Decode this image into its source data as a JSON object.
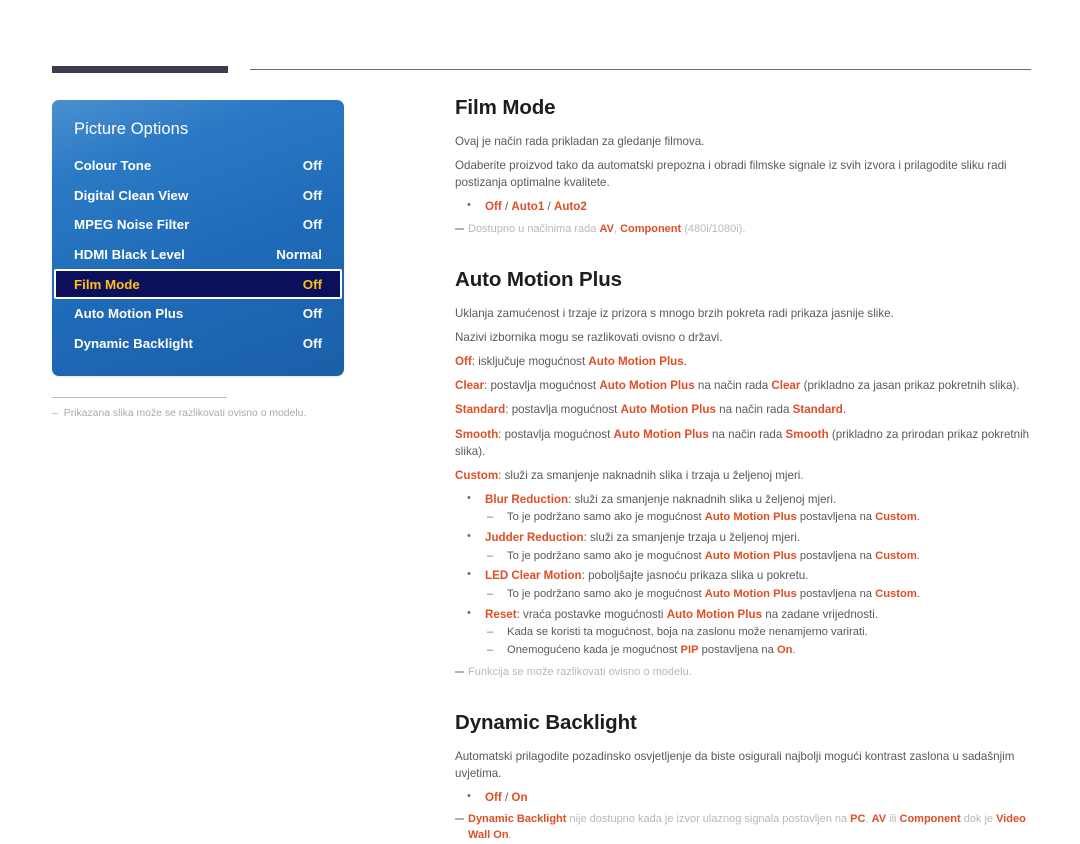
{
  "header": {
    "rule_left": "dark-rule",
    "rule_right": "thin-rule"
  },
  "osd": {
    "title": "Picture Options",
    "rows": [
      {
        "label": "Colour Tone",
        "value": "Off",
        "selected": false
      },
      {
        "label": "Digital Clean View",
        "value": "Off",
        "selected": false
      },
      {
        "label": "MPEG Noise Filter",
        "value": "Off",
        "selected": false
      },
      {
        "label": "HDMI Black Level",
        "value": "Normal",
        "selected": false
      },
      {
        "label": "Film Mode",
        "value": "Off",
        "selected": true
      },
      {
        "label": "Auto Motion Plus",
        "value": "Off",
        "selected": false
      },
      {
        "label": "Dynamic Backlight",
        "value": "Off",
        "selected": false
      }
    ],
    "footnote_dash": "–",
    "footnote": "Prikazana slika može se razlikovati ovisno o modelu."
  },
  "sections": {
    "film_mode": {
      "title": "Film Mode",
      "p1": "Ovaj je način rada prikladan za gledanje filmova.",
      "p2": "Odaberite proizvod tako da automatski prepozna i obradi filmske signale iz svih izvora i prilagodite sliku radi postizanja optimalne kvalitete.",
      "option_off": "Off",
      "option_sep1": " / ",
      "option_auto1": "Auto1",
      "option_sep2": " / ",
      "option_auto2": "Auto2",
      "note_pre": "Dostupno u načinima rada ",
      "note_av": "AV",
      "note_comma": ", ",
      "note_component": "Component",
      "note_post": " (480i/1080i)."
    },
    "auto_motion_plus": {
      "title": "Auto Motion Plus",
      "p1": "Uklanja zamućenost i trzaje iz prizora s mnogo brzih pokreta radi prikaza jasnije slike.",
      "p2": "Nazivi izbornika mogu se razlikovati ovisno o državi.",
      "off_key": "Off",
      "off_mid": ": isključuje mogućnost ",
      "off_term": "Auto Motion Plus",
      "off_end": ".",
      "clear_key": "Clear",
      "clear_mid": ": postavlja mogućnost ",
      "clear_term": "Auto Motion Plus",
      "clear_mid2": " na način rada ",
      "clear_mode": "Clear",
      "clear_end": " (prikladno za jasan prikaz pokretnih slika).",
      "standard_key": "Standard",
      "standard_mid": ": postavlja mogućnost ",
      "standard_term": "Auto Motion Plus",
      "standard_mid2": " na način rada ",
      "standard_mode": "Standard",
      "standard_end": ".",
      "smooth_key": "Smooth",
      "smooth_mid": ": postavlja mogućnost ",
      "smooth_term": "Auto Motion Plus",
      "smooth_mid2": " na način rada ",
      "smooth_mode": "Smooth",
      "smooth_end": " (prikladno za prirodan prikaz pokretnih slika).",
      "custom_key": "Custom",
      "custom_rest": ": služi za smanjenje naknadnih slika i trzaja u željenoj mjeri.",
      "blur_key": "Blur Reduction",
      "blur_rest": ": služi za smanjenje naknadnih slika u željenoj mjeri.",
      "blur_sub_pre": "To je podržano samo ako je mogućnost ",
      "blur_sub_term": "Auto Motion Plus",
      "blur_sub_mid": " postavljena na ",
      "blur_sub_mode": "Custom",
      "blur_sub_end": ".",
      "judder_key": "Judder Reduction",
      "judder_rest": ": služi za smanjenje trzaja u željenoj mjeri.",
      "judder_sub_pre": "To je podržano samo ako je mogućnost ",
      "judder_sub_term": "Auto Motion Plus",
      "judder_sub_mid": " postavljena na ",
      "judder_sub_mode": "Custom",
      "judder_sub_end": ".",
      "led_key": "LED Clear Motion",
      "led_rest": ": poboljšajte jasnoću prikaza slika u pokretu.",
      "led_sub_pre": "To je podržano samo ako je mogućnost ",
      "led_sub_term": "Auto Motion Plus",
      "led_sub_mid": " postavljena na ",
      "led_sub_mode": "Custom",
      "led_sub_end": ".",
      "reset_key": "Reset",
      "reset_mid": ": vraća postavke mogućnosti ",
      "reset_term": "Auto Motion Plus",
      "reset_end": " na zadane vrijednosti.",
      "reset_sub1": "Kada se koristi ta mogućnost, boja na zaslonu može nenamjerno varirati.",
      "reset_sub2_pre": "Onemogućeno kada je mogućnost ",
      "reset_sub2_term": "PIP",
      "reset_sub2_mid": " postavljena na ",
      "reset_sub2_mode": "On",
      "reset_sub2_end": ".",
      "note": "Funkcija se može razlikovati ovisno o modelu."
    },
    "dynamic_backlight": {
      "title": "Dynamic Backlight",
      "p1": "Automatski prilagodite pozadinsko osvjetljenje da biste osigurali najbolji mogući kontrast zaslona u sadašnjim uvjetima.",
      "option_off": "Off",
      "option_sep": " / ",
      "option_on": "On",
      "note_term": "Dynamic Backlight",
      "note_mid1": " nije dostupno kada je izvor ulaznog signala postavljen na ",
      "note_pc": "PC",
      "note_comma": ", ",
      "note_av": "AV",
      "note_ili": " ili ",
      "note_component": "Component",
      "note_mid2": " dok je ",
      "note_vw": "Video Wall On",
      "note_end": "."
    }
  },
  "colors": {
    "accent": "#e04e26",
    "osd_blue_top": "#4a8fd0",
    "osd_blue_bottom": "#1b5fa8",
    "osd_selected_bg": "#0b0f5c",
    "osd_selected_text": "#ffc20e",
    "heading": "#1d1d1b",
    "body": "#5a5a5c",
    "note": "#a7a7ac",
    "header_rule_dark": "#413a4e"
  }
}
